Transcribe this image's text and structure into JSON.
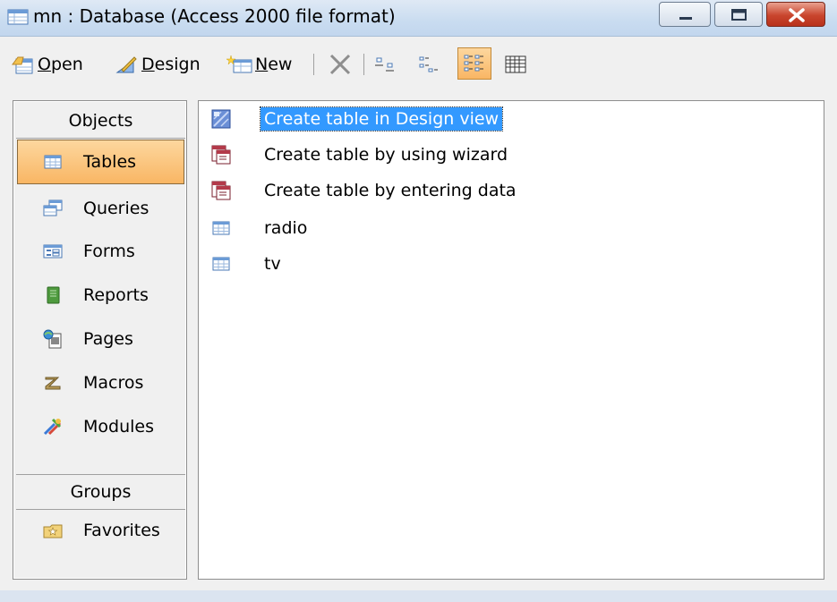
{
  "window": {
    "title": "mn : Database (Access 2000 file format)"
  },
  "toolbar": {
    "open_label": "Open",
    "open_mnemonic": "O",
    "design_label": "Design",
    "design_mnemonic": "D",
    "new_label": "New",
    "new_mnemonic": "N"
  },
  "objects_bar": {
    "header": "Objects",
    "items": [
      {
        "label": "Tables",
        "icon": "table-icon",
        "selected": true
      },
      {
        "label": "Queries",
        "icon": "query-icon"
      },
      {
        "label": "Forms",
        "icon": "form-icon"
      },
      {
        "label": "Reports",
        "icon": "report-icon"
      },
      {
        "label": "Pages",
        "icon": "page-icon"
      },
      {
        "label": "Macros",
        "icon": "macro-icon"
      },
      {
        "label": "Modules",
        "icon": "module-icon"
      }
    ],
    "groups_header": "Groups",
    "groups": [
      {
        "label": "Favorites",
        "icon": "favorites-folder-icon"
      }
    ]
  },
  "main_list": {
    "items": [
      {
        "label": "Create table in Design view",
        "icon": "design-view-icon",
        "selected": true
      },
      {
        "label": "Create table by using wizard",
        "icon": "wizard-icon"
      },
      {
        "label": "Create table by entering data",
        "icon": "wizard-icon"
      },
      {
        "label": "radio",
        "icon": "table-icon"
      },
      {
        "label": "tv",
        "icon": "table-icon"
      }
    ]
  },
  "colors": {
    "selection_blue": "#3399ff",
    "selected_tab_orange": "#f9b664",
    "titlebar_blue": "#c9dcf0",
    "close_red": "#c9452d"
  }
}
